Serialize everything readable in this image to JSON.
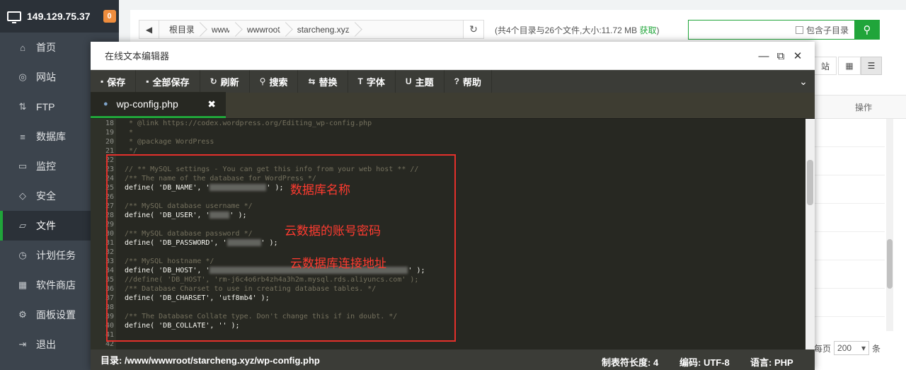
{
  "sidebar": {
    "host": "149.129.75.37",
    "badge": "0",
    "items": [
      {
        "label": "首页",
        "icon": "home-icon"
      },
      {
        "label": "网站",
        "icon": "globe-icon"
      },
      {
        "label": "FTP",
        "icon": "ftp-icon"
      },
      {
        "label": "数据库",
        "icon": "database-icon"
      },
      {
        "label": "监控",
        "icon": "monitor-icon"
      },
      {
        "label": "安全",
        "icon": "shield-icon"
      },
      {
        "label": "文件",
        "icon": "folder-icon"
      },
      {
        "label": "计划任务",
        "icon": "clock-icon"
      },
      {
        "label": "软件商店",
        "icon": "grid-icon"
      },
      {
        "label": "面板设置",
        "icon": "gear-icon"
      },
      {
        "label": "退出",
        "icon": "logout-icon"
      }
    ],
    "active": "文件"
  },
  "filemanager": {
    "breadcrumbs": [
      "根目录",
      "www",
      "wwwroot",
      "starcheng.xyz"
    ],
    "dir_info": "(共4个目录与26个文件,大小:11.72 MB",
    "dir_info_get": "获取",
    "dir_info_close": ")",
    "include_subdir": "包含子目录",
    "recycle_label": "站",
    "ops_header": "操作",
    "per_page_label": "每页",
    "per_page_value": "200",
    "per_page_suffix": "条"
  },
  "editor": {
    "title": "在线文本编辑器",
    "toolbar": [
      {
        "label": "保存",
        "icon": "save-icon",
        "glyph": "▪"
      },
      {
        "label": "全部保存",
        "icon": "save-all-icon",
        "glyph": "▪"
      },
      {
        "label": "刷新",
        "icon": "refresh-icon",
        "glyph": "↻"
      },
      {
        "label": "搜索",
        "icon": "search-icon",
        "glyph": "⚲"
      },
      {
        "label": "替换",
        "icon": "replace-icon",
        "glyph": "⇆"
      },
      {
        "label": "字体",
        "icon": "font-icon",
        "glyph": "T"
      },
      {
        "label": "主题",
        "icon": "theme-icon",
        "glyph": "U"
      },
      {
        "label": "帮助",
        "icon": "help-icon",
        "glyph": "?"
      }
    ],
    "tab_name": "wp-config.php",
    "status": {
      "dir": "目录: /www/wwwroot/starcheng.xyz/wp-config.php",
      "tab_size": "制表符长度: 4",
      "encoding": "编码: UTF-8",
      "language": "语言: PHP"
    },
    "code_lines": [
      {
        "n": "18",
        "text": " * @link https://codex.wordpress.org/Editing_wp-config.php",
        "cls": "cm"
      },
      {
        "n": "19",
        "text": " *",
        "cls": "cm"
      },
      {
        "n": "20",
        "text": " * @package WordPress",
        "cls": "cm"
      },
      {
        "n": "21",
        "text": " */",
        "cls": "cm"
      },
      {
        "n": "22",
        "text": "",
        "cls": "cm"
      },
      {
        "n": "23",
        "text": "// ** MySQL settings - You can get this info from your web host ** //",
        "cls": "cm"
      },
      {
        "n": "24",
        "text": "/** The name of the database for WordPress */",
        "cls": "cm"
      },
      {
        "n": "25",
        "text": "define( 'DB_NAME', '",
        "cls": "pl",
        "blur": 80,
        "tail": "' );"
      },
      {
        "n": "26",
        "text": "",
        "cls": "cm"
      },
      {
        "n": "27",
        "text": "/** MySQL database username */",
        "cls": "cm"
      },
      {
        "n": "28",
        "text": "define( 'DB_USER', '",
        "cls": "pl",
        "blur": 28,
        "tail": "' );"
      },
      {
        "n": "29",
        "text": "",
        "cls": "cm"
      },
      {
        "n": "30",
        "text": "/** MySQL database password */",
        "cls": "cm"
      },
      {
        "n": "31",
        "text": "define( 'DB_PASSWORD', '",
        "cls": "pl",
        "blur": 48,
        "tail": "' );"
      },
      {
        "n": "32",
        "text": "",
        "cls": "cm"
      },
      {
        "n": "33",
        "text": "/** MySQL hostname */",
        "cls": "cm"
      },
      {
        "n": "34",
        "text": "define( 'DB_HOST', '",
        "cls": "pl",
        "blur": 280,
        "tail": "' );"
      },
      {
        "n": "35",
        "text": "//define( 'DB_HOST', 'rm-j6c4o6rb4zh4a3h2m.mysql.rds.aliyuncs.com' );",
        "cls": "cm"
      },
      {
        "n": "36",
        "text": "/** Database Charset to use in creating database tables. */",
        "cls": "cm"
      },
      {
        "n": "37",
        "text": "define( 'DB_CHARSET', 'utf8mb4' );",
        "cls": "pl"
      },
      {
        "n": "38",
        "text": "",
        "cls": "cm"
      },
      {
        "n": "39",
        "text": "/** The Database Collate type. Don't change this if in doubt. */",
        "cls": "cm"
      },
      {
        "n": "40",
        "text": "define( 'DB_COLLATE', '' );",
        "cls": "pl"
      },
      {
        "n": "41",
        "text": "",
        "cls": "cm"
      },
      {
        "n": "42",
        "text": "",
        "cls": "cm"
      }
    ]
  },
  "annotations": {
    "db_name": "数据库名称",
    "account": "云数据的账号密码",
    "host": "云数据库连接地址"
  },
  "colors": {
    "accent": "#20a53a",
    "annotation": "#e4302b"
  }
}
